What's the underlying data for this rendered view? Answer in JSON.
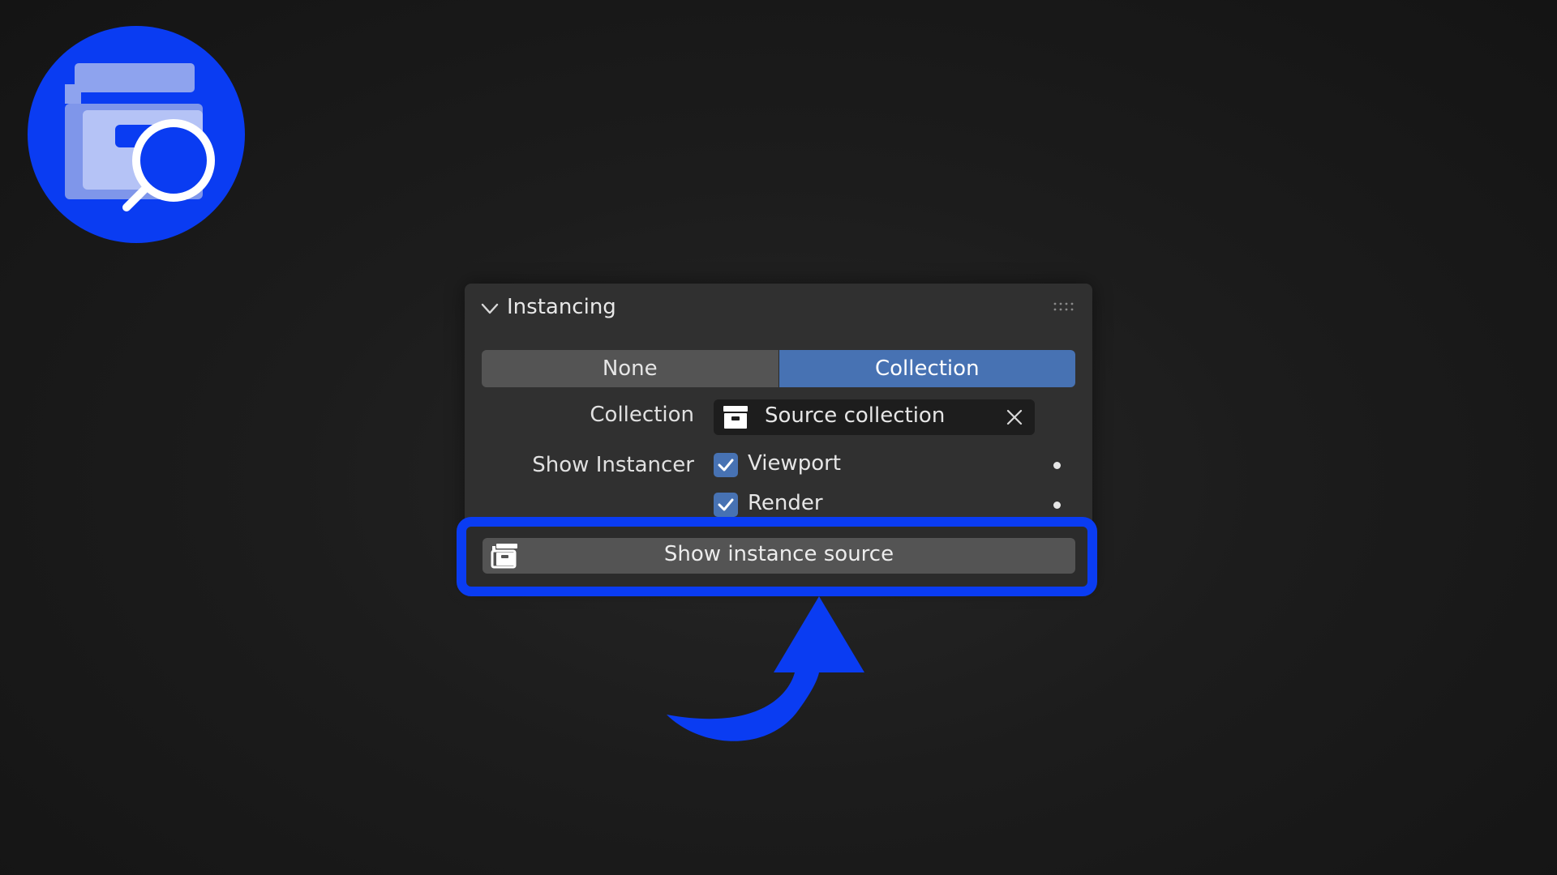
{
  "panel": {
    "title": "Instancing",
    "mode_options": [
      "None",
      "Collection"
    ],
    "selected_mode": "Collection",
    "collection_label": "Collection",
    "collection_value": "Source collection",
    "show_instancer_label": "Show Instancer",
    "viewport_label": "Viewport",
    "viewport_checked": true,
    "render_label": "Render",
    "render_checked": true,
    "action_label": "Show instance source"
  },
  "icons": {
    "logo": "collection-search-icon",
    "chevron": "chevron-down-icon",
    "grip": "drag-grip-icon",
    "collection": "collection-box-icon",
    "clear": "close-icon",
    "action": "collection-stack-icon",
    "arrow": "curved-arrow-up-icon"
  },
  "colors": {
    "accent_blue": "#0a3cf2",
    "selected_blue": "#4772b3",
    "panel_bg": "#303030",
    "button_bg": "#545454",
    "field_bg": "#1d1d1d"
  }
}
